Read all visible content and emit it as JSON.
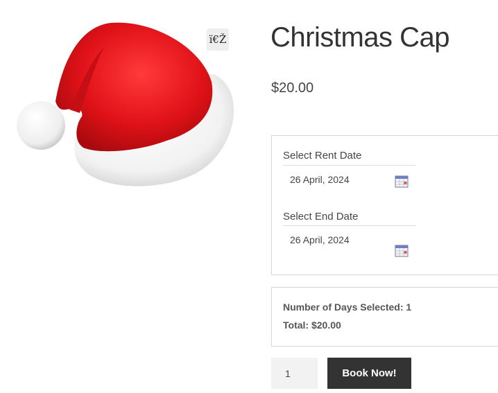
{
  "product": {
    "title": "Christmas Cap",
    "price": "$20.00",
    "zoom_glyph": "ï€Ž",
    "image_name": "santa-hat-image"
  },
  "booking": {
    "rent_label": "Select Rent Date",
    "rent_value": "26 April, 2024",
    "end_label": "Select End Date",
    "end_value": "26 April, 2024",
    "calendar_icon": "calendar-icon"
  },
  "summary": {
    "days": "Number of Days Selected: 1",
    "total": "Total: $20.00"
  },
  "cart": {
    "quantity": "1",
    "book_label": "Book Now!"
  },
  "colors": {
    "button_bg": "#333333",
    "hat_red": "#e01218",
    "border": "#d6d6d6"
  }
}
